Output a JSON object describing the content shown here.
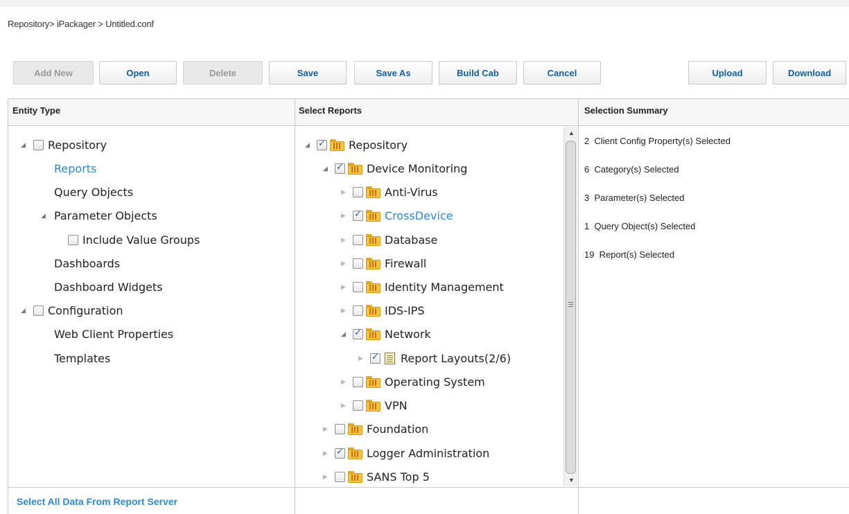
{
  "breadcrumb": "Repository> iPackager > Untitled.conf",
  "toolbar": {
    "add_new": "Add New",
    "open": "Open",
    "delete": "Delete",
    "save": "Save",
    "save_as": "Save As",
    "build_cab": "Build Cab",
    "cancel": "Cancel",
    "upload": "Upload",
    "download": "Download"
  },
  "columns": {
    "entity_type": "Entity Type",
    "select_reports": "Select Reports",
    "selection_summary": "Selection Summary"
  },
  "entity_tree": {
    "repository": "Repository",
    "reports": "Reports",
    "query_objects": "Query Objects",
    "parameter_objects": "Parameter Objects",
    "include_value_groups": "Include Value Groups",
    "dashboards": "Dashboards",
    "dashboard_widgets": "Dashboard Widgets",
    "configuration": "Configuration",
    "web_client_properties": "Web Client Properties",
    "templates": "Templates"
  },
  "reports_tree": {
    "repository": "Repository",
    "device_monitoring": "Device Monitoring",
    "anti_virus": "Anti-Virus",
    "crossdevice": "CrossDevice",
    "database": "Database",
    "firewall": "Firewall",
    "identity_management": "Identity Management",
    "ids_ips": "IDS-IPS",
    "network": "Network",
    "report_layouts": "Report Layouts(2/6)",
    "operating_system": "Operating System",
    "vpn": "VPN",
    "foundation": "Foundation",
    "logger_administration": "Logger Administration",
    "sans_top5": "SANS Top 5"
  },
  "summary": [
    "2  Client Config Property(s) Selected",
    "6  Category(s) Selected",
    "3  Parameter(s) Selected",
    "1  Query Object(s) Selected",
    "19  Report(s) Selected"
  ],
  "footer_link": "Select All Data From Report Server",
  "icons": {
    "expanded": "triangle-expanded-icon",
    "collapsed": "triangle-collapsed-icon",
    "folder": "report-folder-icon",
    "document": "report-layout-icon"
  },
  "colors": {
    "link": "#2a8ad7",
    "button_text": "#0f5fa8",
    "disabled_text": "#9a9a9a"
  }
}
